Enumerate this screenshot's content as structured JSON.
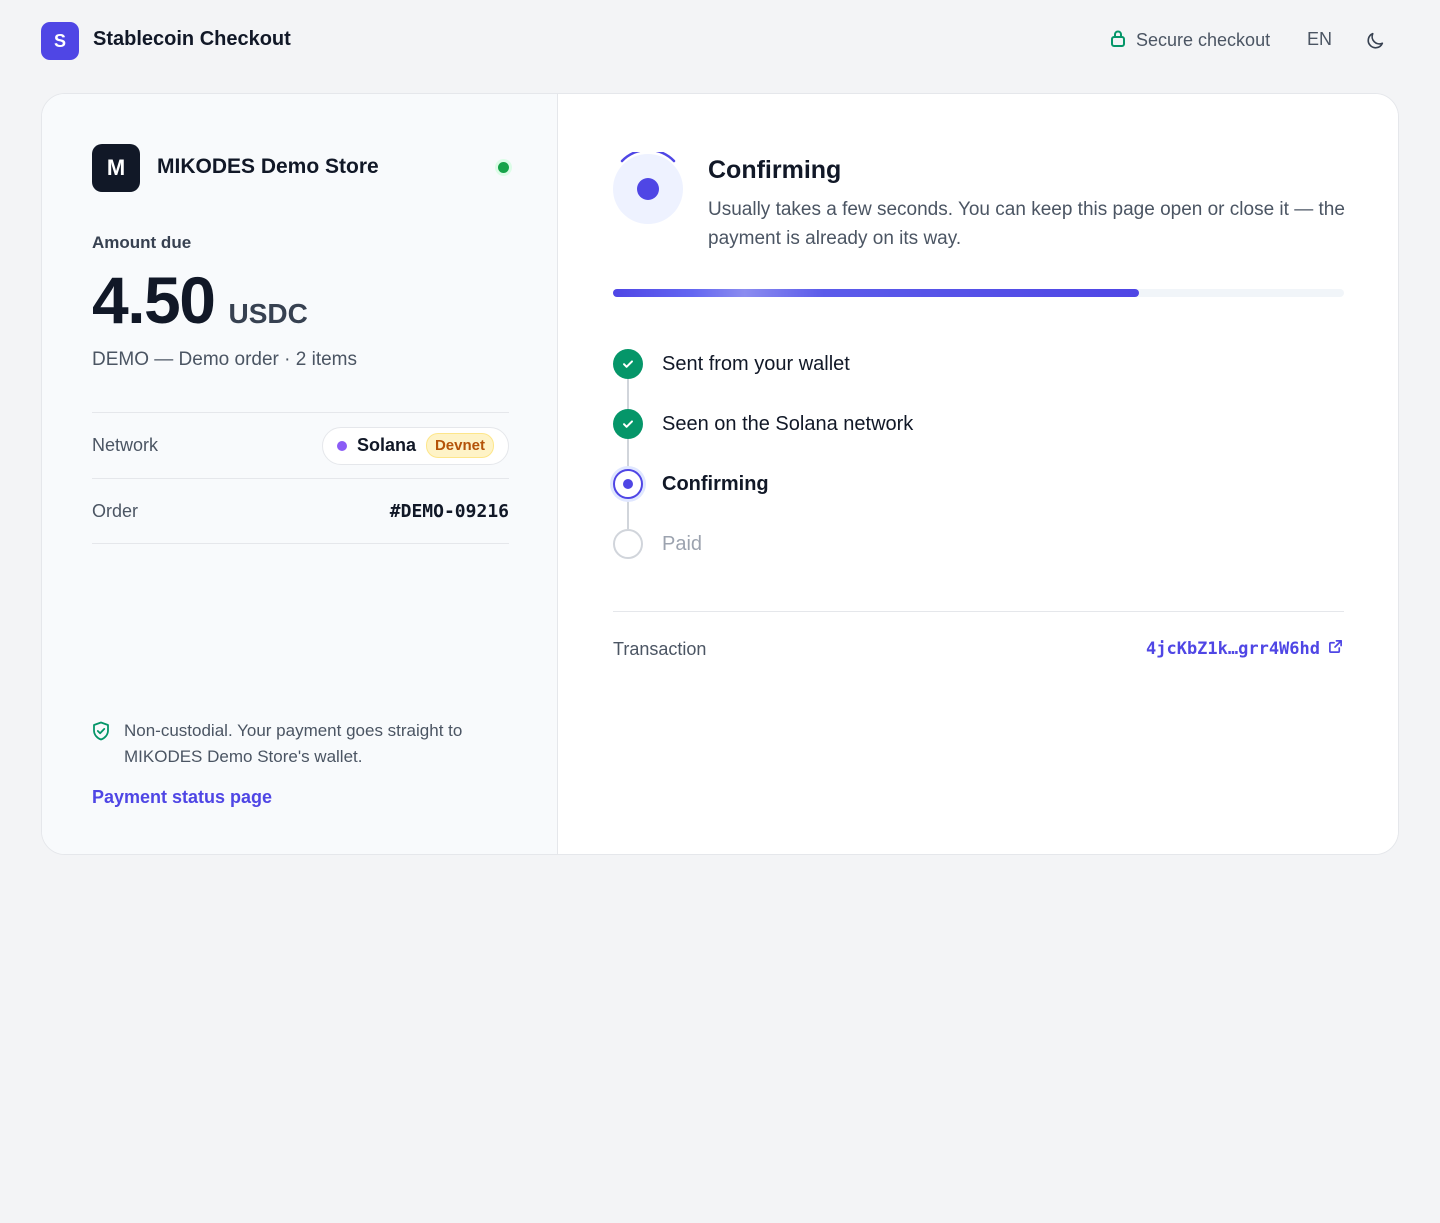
{
  "header": {
    "logo_letter": "S",
    "title": "Stablecoin Checkout",
    "secure_label": "Secure checkout",
    "language": "EN",
    "theme_icon": "moon-icon"
  },
  "merchant": {
    "avatar_letter": "M",
    "name": "MIKODES Demo Store",
    "online_color": "#16a34a"
  },
  "payment": {
    "amount_label": "Amount due",
    "amount": "4.50",
    "currency": "USDC",
    "description": "DEMO — Demo order · 2 items",
    "network_label": "Network",
    "network_name": "Solana",
    "network_badge": "Devnet",
    "order_label": "Order",
    "order_id": "#DEMO-09216"
  },
  "footer": {
    "note": "Non-custodial. Your payment goes straight to MIKODES Demo Store's wallet.",
    "status_link": "Payment status page"
  },
  "status": {
    "title": "Confirming",
    "subtitle": "Usually takes a few seconds. You can keep this page open or close it — the payment is already on its way.",
    "progress_fraction": 0.72,
    "steps": [
      {
        "label": "Sent from your wallet",
        "state": "done"
      },
      {
        "label": "Seen on the Solana network",
        "state": "done"
      },
      {
        "label": "Confirming",
        "state": "active"
      },
      {
        "label": "Paid",
        "state": "pending"
      }
    ]
  },
  "transaction": {
    "label": "Transaction",
    "hash": "4jcKbZ1k…grr4W6hd"
  },
  "colors": {
    "accent": "#4f46e5",
    "success": "#059669",
    "devnet_badge": "#b45309"
  }
}
